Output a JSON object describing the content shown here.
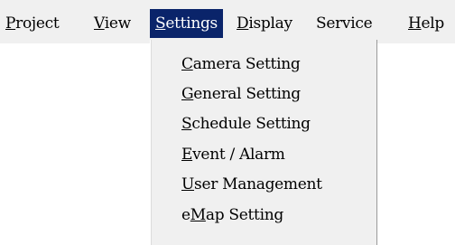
{
  "menubar": {
    "items": [
      {
        "ul": "P",
        "rest": "roject",
        "pre": ""
      },
      {
        "ul": "V",
        "rest": "iew",
        "pre": ""
      },
      {
        "ul": "S",
        "rest": "ettings",
        "pre": ""
      },
      {
        "ul": "D",
        "rest": "isplay",
        "pre": ""
      },
      {
        "ul": "",
        "rest": "Service",
        "pre": ""
      },
      {
        "ul": "H",
        "rest": "elp",
        "pre": ""
      }
    ],
    "active_index": 2
  },
  "settings_menu": {
    "items": [
      {
        "pre": "",
        "ul": "C",
        "rest": "amera Setting"
      },
      {
        "pre": "",
        "ul": "G",
        "rest": "eneral Setting"
      },
      {
        "pre": "",
        "ul": "S",
        "rest": "chedule Setting"
      },
      {
        "pre": "",
        "ul": "E",
        "rest": "vent / Alarm"
      },
      {
        "pre": "",
        "ul": "U",
        "rest": "ser Management"
      },
      {
        "pre": "e",
        "ul": "M",
        "rest": "ap Setting"
      }
    ]
  },
  "colors": {
    "menubar_bg": "#f0f0f0",
    "highlight_bg": "#0a246a",
    "highlight_text": "#ffffff"
  }
}
